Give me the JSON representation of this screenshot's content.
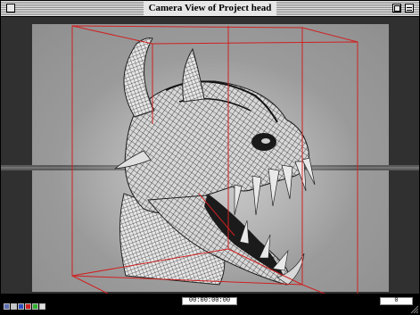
{
  "window": {
    "title": "Camera View of Project head"
  },
  "viewport": {
    "subject_icon": "demon-head-wireframe-render",
    "bounding_box_color": "#d02020",
    "horizon_color": "#606060",
    "canvas_color": "#9b9b9b"
  },
  "toolbar": {
    "icons": [
      "camera-icon",
      "light-icon",
      "color-swatch-icon",
      "red-swatch-icon",
      "green-swatch-icon",
      "render-icon"
    ]
  },
  "status": {
    "timecode": "00:00:00:00",
    "frame": "0"
  }
}
